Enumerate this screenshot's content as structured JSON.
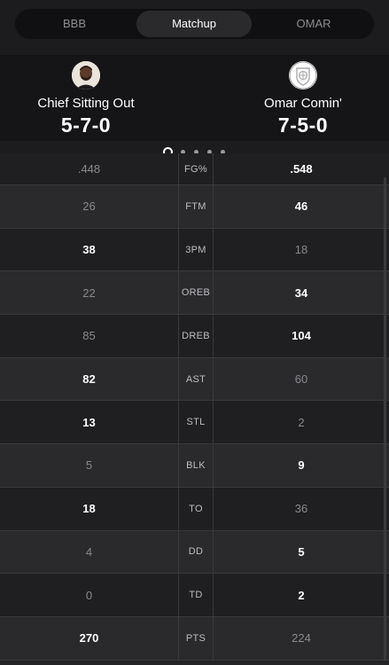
{
  "tabs": [
    {
      "label": "BBB",
      "active": false
    },
    {
      "label": "Matchup",
      "active": true
    },
    {
      "label": "OMAR",
      "active": false
    }
  ],
  "teams": {
    "left": {
      "name": "Chief Sitting Out",
      "record": "5-7-0"
    },
    "right": {
      "name": "Omar Comin'",
      "record": "7-5-0"
    }
  },
  "pagination": {
    "count": 5,
    "active_index": 0
  },
  "stats": [
    {
      "category": "FG%",
      "left": ".448",
      "right": ".548",
      "winner": "right"
    },
    {
      "category": "FTM",
      "left": "26",
      "right": "46",
      "winner": "right"
    },
    {
      "category": "3PM",
      "left": "38",
      "right": "18",
      "winner": "left"
    },
    {
      "category": "OREB",
      "left": "22",
      "right": "34",
      "winner": "right"
    },
    {
      "category": "DREB",
      "left": "85",
      "right": "104",
      "winner": "right"
    },
    {
      "category": "AST",
      "left": "82",
      "right": "60",
      "winner": "left"
    },
    {
      "category": "STL",
      "left": "13",
      "right": "2",
      "winner": "left"
    },
    {
      "category": "BLK",
      "left": "5",
      "right": "9",
      "winner": "right"
    },
    {
      "category": "TO",
      "left": "18",
      "right": "36",
      "winner": "left"
    },
    {
      "category": "DD",
      "left": "4",
      "right": "5",
      "winner": "right"
    },
    {
      "category": "TD",
      "left": "0",
      "right": "2",
      "winner": "right"
    },
    {
      "category": "PTS",
      "left": "270",
      "right": "224",
      "winner": "left"
    }
  ],
  "colors": {
    "background": "#242426",
    "header": "#151517",
    "active_tab": "#2a2a2c"
  }
}
